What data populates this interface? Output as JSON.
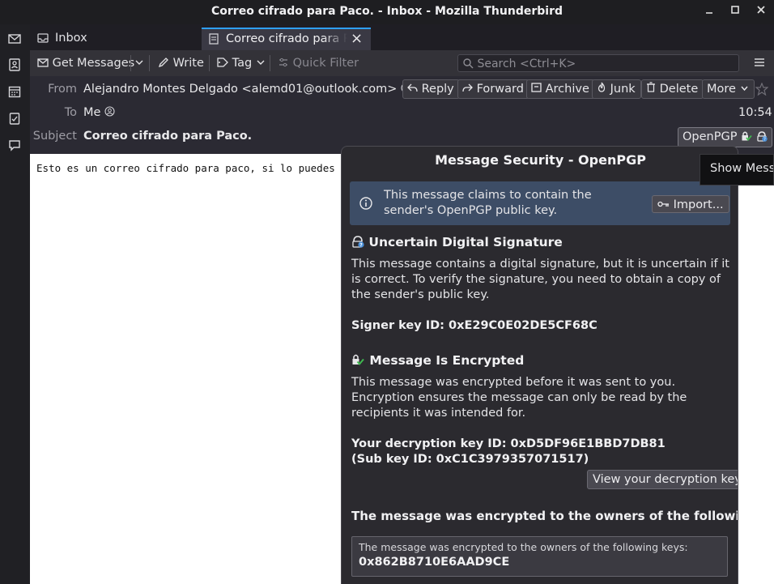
{
  "window": {
    "title": "Correo cifrado para Paco. - Inbox - Mozilla Thunderbird",
    "minimize_icon": "minimize-icon",
    "maximize_icon": "maximize-icon",
    "close_icon": "close-icon"
  },
  "spaces": [
    "mail-icon",
    "address-book-icon",
    "calendar-icon",
    "tasks-icon",
    "chat-icon"
  ],
  "tabs": [
    {
      "label": "Inbox",
      "icon": "inbox-tray-icon"
    },
    {
      "label": "Correo cifrado para Paco.",
      "icon": "message-icon",
      "close": "×"
    }
  ],
  "toolbar": {
    "get_messages": "Get Messages",
    "write": "Write",
    "tag": "Tag",
    "quick_filter": "Quick Filter",
    "search_placeholder": "Search <Ctrl+K>",
    "menu_icon": "hamburger-menu-icon"
  },
  "header": {
    "from_label": "From",
    "from_value": "Alejandro Montes Delgado <alemd01@outlook.com>",
    "to_label": "To",
    "to_value": "Me",
    "subject_label": "Subject",
    "subject_value": "Correo cifrado para Paco.",
    "time": "10:54",
    "buttons": {
      "reply": "Reply",
      "forward": "Forward",
      "archive": "Archive",
      "junk": "Junk",
      "delete": "Delete",
      "more": "More"
    },
    "openpgp_label": "OpenPGP"
  },
  "message": {
    "body": "Esto es un correo cifrado para paco, si lo puedes ve"
  },
  "tooltip": {
    "text": "Show Message Security"
  },
  "security_popup": {
    "title": "Message Security - OpenPGP",
    "notice_text": "This message claims to contain the sender's OpenPGP public key.",
    "import_button": "Import...",
    "signature_heading": "Uncertain Digital Signature",
    "signature_text": "This message contains a digital signature, but it is uncertain if it is correct. To verify the signature, you need to obtain a copy of the sender's public key.",
    "signer_key_id": "Signer key ID: 0xE29C0E02DE5CF68C",
    "encryption_heading": "Message Is Encrypted",
    "encryption_text": "This message was encrypted before it was sent to you. Encryption ensures the message can only be read by the recipients it was intended for.",
    "decryption_key_id": "Your decryption key ID: 0xD5DF96E1BBD7DB81 (Sub key ID: 0xC1C3979357071517)",
    "view_key_button": "View your decryption key",
    "recipients_heading": "The message was encrypted to the owners of the following keys:",
    "recipients_box_label": "The message was encrypted to the owners of the following keys:",
    "recipient_key": "0x862B8710E6AAD9CE"
  },
  "colors": {
    "accent": "#2ea0ff",
    "notice_bg": "#3d4d66",
    "signature_status": "#4a90d9",
    "encrypted_status": "#3fb950"
  }
}
